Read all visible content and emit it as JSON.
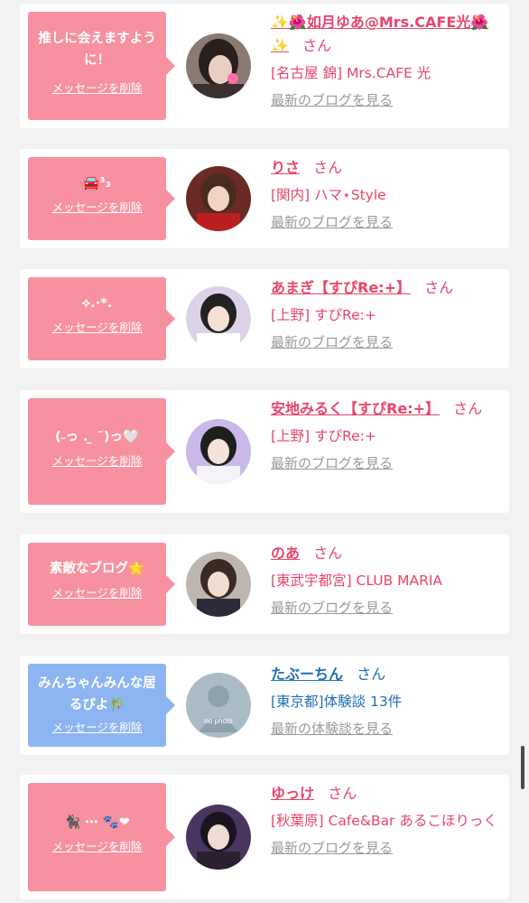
{
  "entries": [
    {
      "message": "推しに会えますように！",
      "delete_label": "メッセージを削除",
      "name": "✨🌺如月ゆあ@Mrs.CAFE光🌺✨",
      "suffix": "さん",
      "shop": "[名古屋 錦] Mrs.CAFE 光",
      "link": "最新のブログを見る",
      "bubble_color": "#f7909f",
      "text_color": "#e8456a"
    },
    {
      "message": "🚘³₃",
      "delete_label": "メッセージを削除",
      "name": "りさ",
      "suffix": "さん",
      "shop": "[関内] ハマ⋆Style",
      "link": "最新のブログを見る",
      "bubble_color": "#f7909f",
      "text_color": "#e8456a"
    },
    {
      "message": "⟡.·*.",
      "delete_label": "メッセージを削除",
      "name": "あまぎ【すぴRe:+】",
      "suffix": "さん",
      "shop": "[上野] すぴRe:+",
      "link": "最新のブログを見る",
      "bubble_color": "#f7909f",
      "text_color": "#e8456a"
    },
    {
      "message": "(˶っ . ̫ ˘)っ🤍",
      "delete_label": "メッセージを削除",
      "name": "安地みるく【すぴRe:+】",
      "suffix": "さん",
      "shop": "[上野] すぴRe:+",
      "link": "最新のブログを見る",
      "bubble_color": "#f7909f",
      "text_color": "#e8456a"
    },
    {
      "message": "素敵なブログ🌟",
      "delete_label": "メッセージを削除",
      "name": "のあ",
      "suffix": "さん",
      "shop": "[東武宇都宮] CLUB MARIA",
      "link": "最新のブログを見る",
      "bubble_color": "#f7909f",
      "text_color": "#e8456a"
    },
    {
      "message": "みんちゃんみんな居るぴよ🎋",
      "delete_label": "メッセージを削除",
      "name": "たぶーちん",
      "suffix": "さん",
      "shop": "[東京都]体験談 13件",
      "link": "最新の体験談を見る",
      "avatar_caption": "no photo",
      "bubble_color": "#8cb5f2",
      "text_color": "#1f6fb8"
    },
    {
      "message": "🐈‍⬛ ⋯ 🐾❤",
      "delete_label": "メッセージを削除",
      "name": "ゆっけ",
      "suffix": "さん",
      "shop": "[秋葉原] Cafe&Bar あるこほりっく",
      "link": "最新のブログを見る",
      "bubble_color": "#f7909f",
      "text_color": "#e8456a"
    }
  ]
}
